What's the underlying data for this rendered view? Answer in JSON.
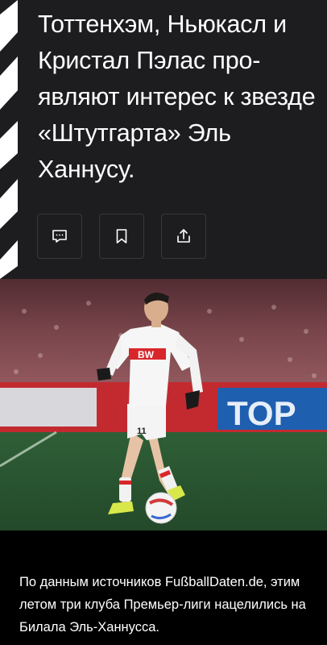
{
  "article": {
    "title": "Тоттенхэм, Ньюкасл и Кристал Пэлас про-являют интерес к звезде «Штутгарта» Эль Ханнусу.",
    "caption": "По данным источников FußballDaten.de, этим летом три клуба Премьер-лиги нацелились на Билала Эль-Ханнусса."
  },
  "actions": [
    {
      "name": "comment",
      "icon": "comment-icon"
    },
    {
      "name": "bookmark",
      "icon": "bookmark-icon"
    },
    {
      "name": "share",
      "icon": "share-icon"
    }
  ],
  "photo": {
    "sponsor_text": "BW",
    "shirt_number": "11",
    "board_text": "TOP"
  },
  "colors": {
    "header_bg": "#1d1d20",
    "text": "#ffffff",
    "page_bg": "#000000",
    "kit_red": "#d9262b"
  }
}
